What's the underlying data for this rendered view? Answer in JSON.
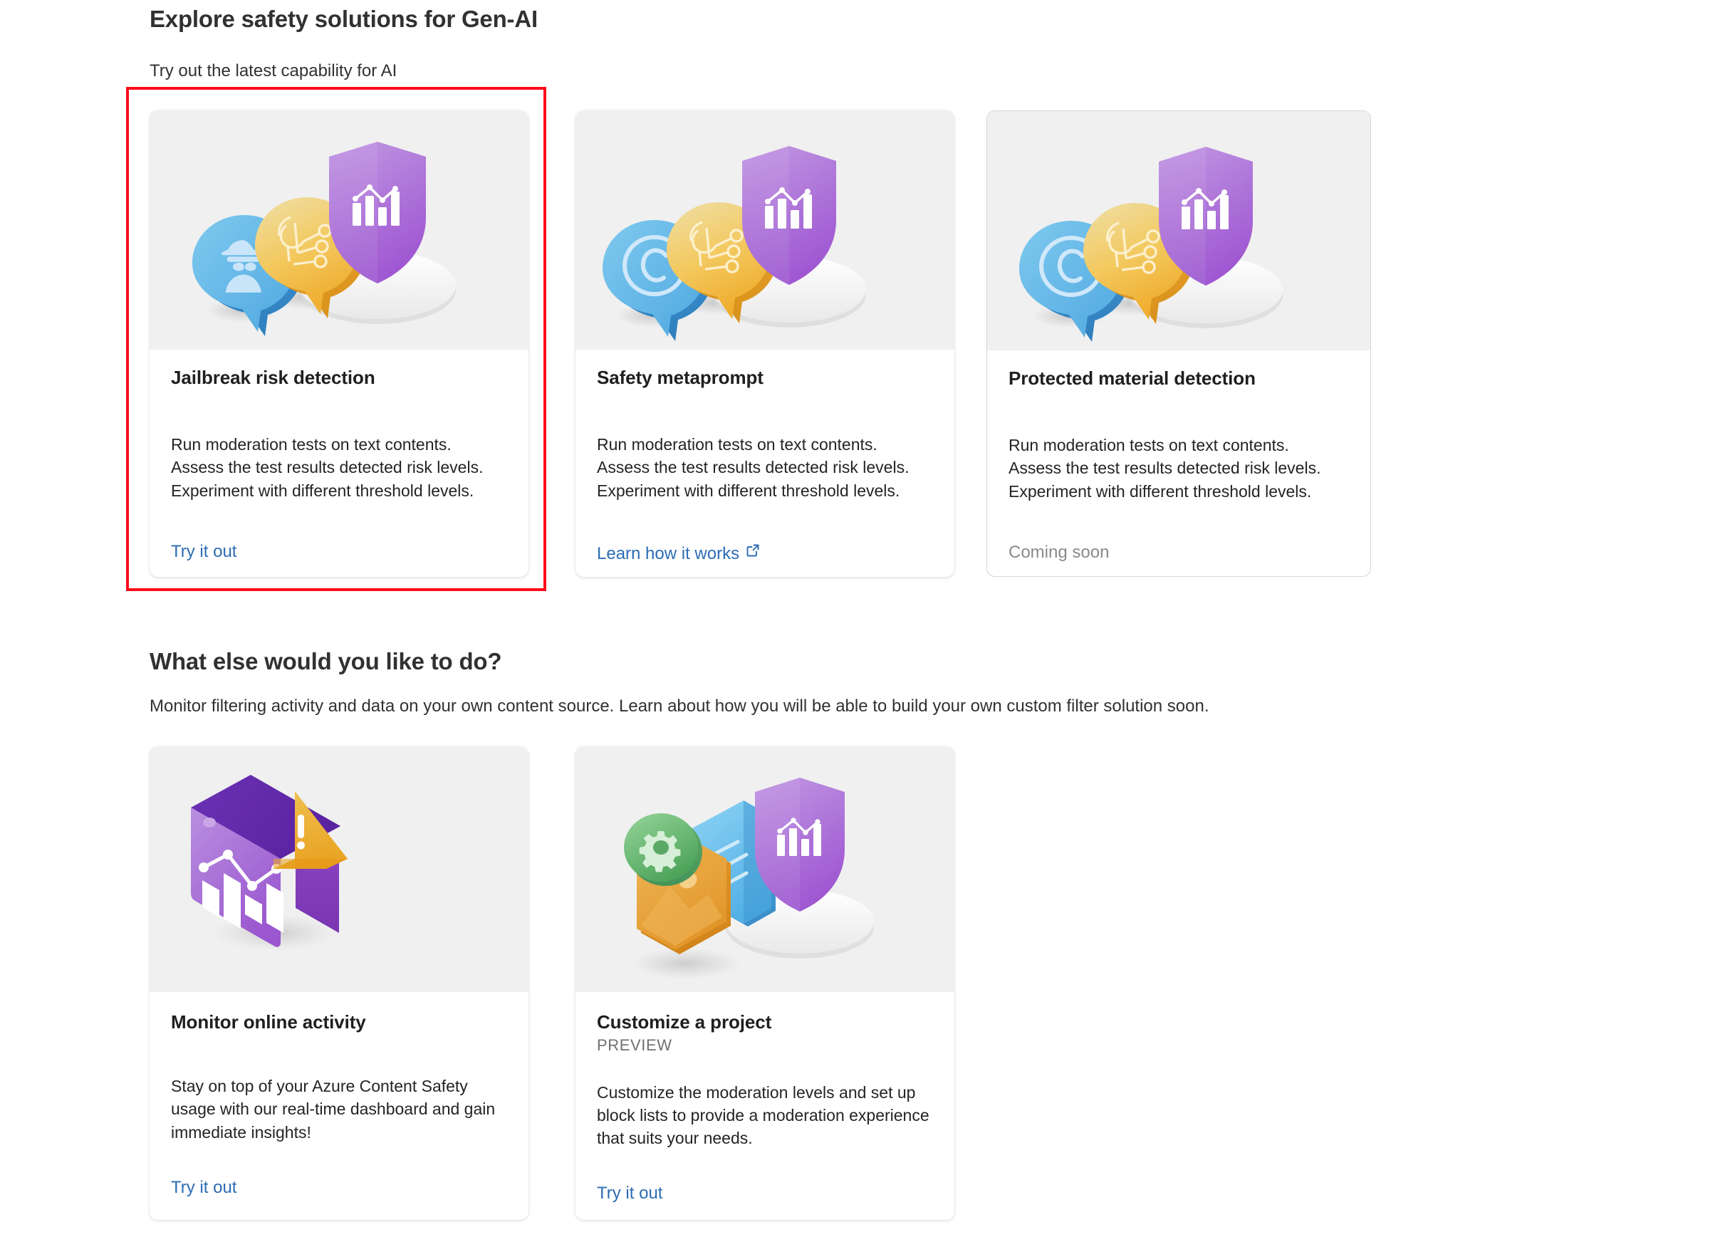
{
  "sections": [
    {
      "title": "Explore safety solutions for Gen-AI",
      "subtitle": "Try out the latest capability for AI"
    },
    {
      "title": "What else would you like to do?",
      "subtitle": "Monitor filtering activity and data on your own content source. Learn about how you will be able to build your own custom filter solution soon."
    }
  ],
  "cards_top": [
    {
      "title": "Jailbreak risk detection",
      "description": "Run moderation tests on text contents.\nAssess the test results detected risk levels.\nExperiment with different threshold levels.",
      "action_label": "Try it out",
      "action_type": "link",
      "illustration": "spy-bubble-ai-bubble-shield-chart-illustration",
      "selected": true
    },
    {
      "title": "Safety metaprompt",
      "description": "Run moderation tests on text contents.\nAssess the test results detected risk levels.\nExperiment with different threshold levels.",
      "action_label": "Learn how it works",
      "action_type": "external-link",
      "illustration": "copyright-bubble-ai-bubble-shield-chart-illustration",
      "selected": false
    },
    {
      "title": "Protected material detection",
      "description": "Run moderation tests on text contents.\nAssess the test results detected risk levels.\nExperiment with different threshold levels.",
      "action_label": "Coming soon",
      "action_type": "disabled",
      "illustration": "copyright-bubble-ai-bubble-shield-chart-illustration",
      "selected": false
    }
  ],
  "cards_bottom": [
    {
      "title": "Monitor online activity",
      "badge": "",
      "description": "Stay on top of your Azure Content Safety usage with our real-time dashboard and gain immediate insights!",
      "action_label": "Try it out",
      "action_type": "link",
      "illustration": "dashboard-window-warning-illustration"
    },
    {
      "title": "Customize a project",
      "badge": "PREVIEW",
      "description": "Customize the moderation levels and set up block lists to provide a moderation experience that suits your needs.",
      "action_label": "Try it out",
      "action_type": "link",
      "illustration": "gear-image-document-shield-illustration"
    }
  ],
  "colors": {
    "link": "#2d6cb5",
    "highlight": "#fc0d1b",
    "muted": "#8a8a8a",
    "media_bg": "#f0f0f0",
    "card_bg": "#ffffff"
  },
  "icons": {
    "external_link": "open-in-new-window-icon"
  }
}
